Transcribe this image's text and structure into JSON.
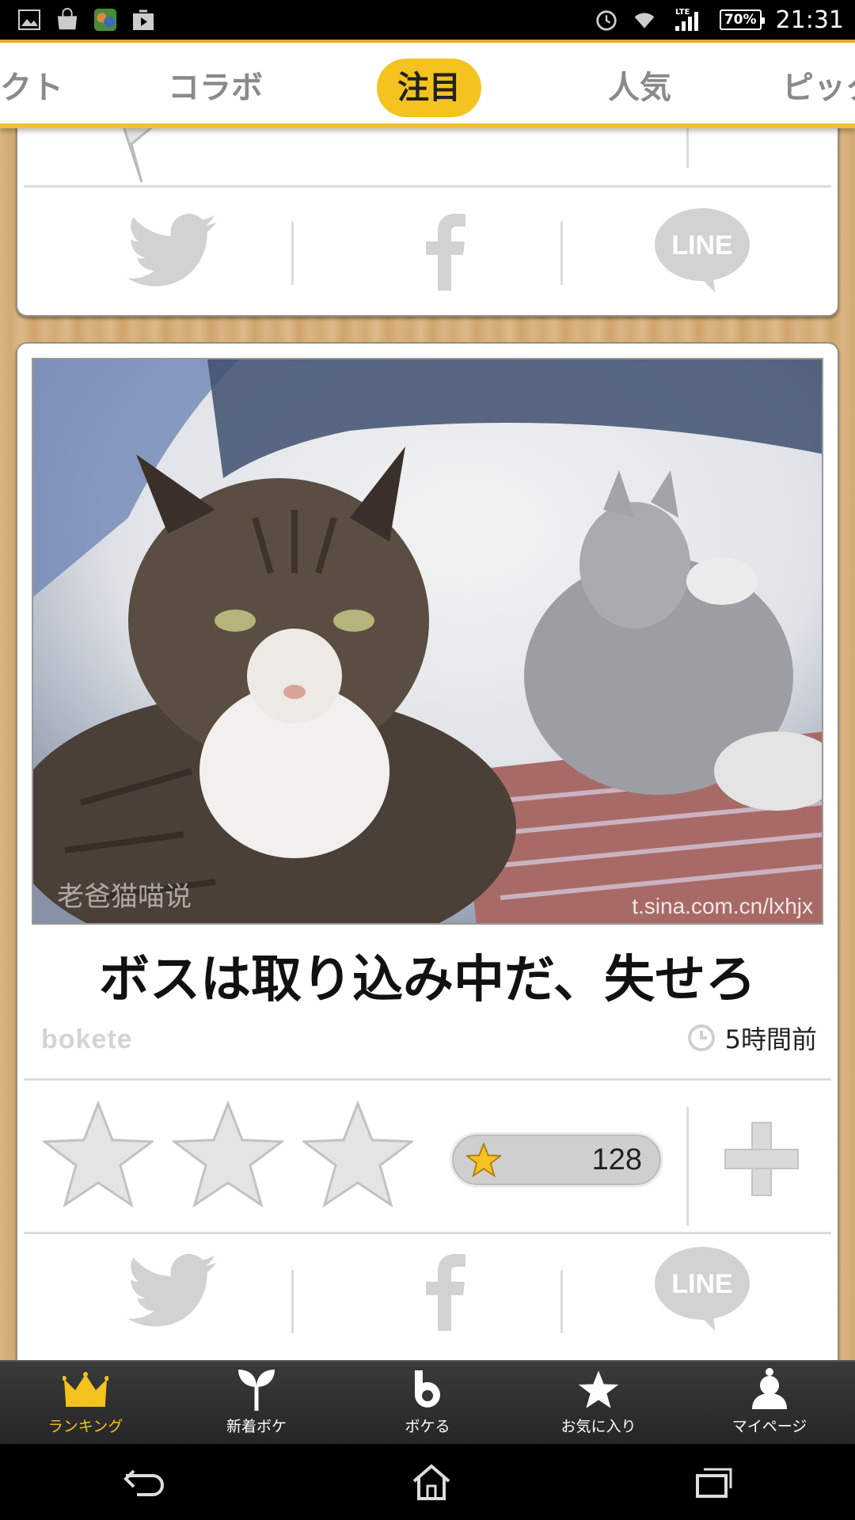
{
  "status_bar": {
    "time": "21:31",
    "battery": "70%",
    "network": "LTE",
    "notification_icons": [
      "gallery-icon",
      "market-icon",
      "game-icon",
      "play-store-icon"
    ]
  },
  "tabs": [
    {
      "label": "クト"
    },
    {
      "label": "コラボ"
    },
    {
      "label": "注目",
      "active": true
    },
    {
      "label": "人気"
    },
    {
      "label": "ピック"
    }
  ],
  "top_card": {
    "share": [
      "twitter-icon",
      "facebook-icon",
      "line-icon"
    ],
    "line_label": "LINE"
  },
  "post": {
    "caption": "ボスは取り込み中だ、失せろ",
    "watermark_left": "老爸猫喵说",
    "watermark_right": "t.sina.com.cn/lxhjx",
    "brand": "bokete",
    "time_ago": "5時間前",
    "star_count": "128",
    "line_label": "LINE"
  },
  "bottom_nav": [
    {
      "label": "ランキング",
      "icon": "crown-icon",
      "active": true
    },
    {
      "label": "新着ボケ",
      "icon": "sprout-icon"
    },
    {
      "label": "ボケる",
      "icon": "bokete-b-icon"
    },
    {
      "label": "お気に入り",
      "icon": "star-icon"
    },
    {
      "label": "マイページ",
      "icon": "profile-icon"
    }
  ],
  "colors": {
    "accent": "#f4c31f",
    "tab_border": "#e8a82c",
    "icon_gray": "#cfcfcf"
  }
}
